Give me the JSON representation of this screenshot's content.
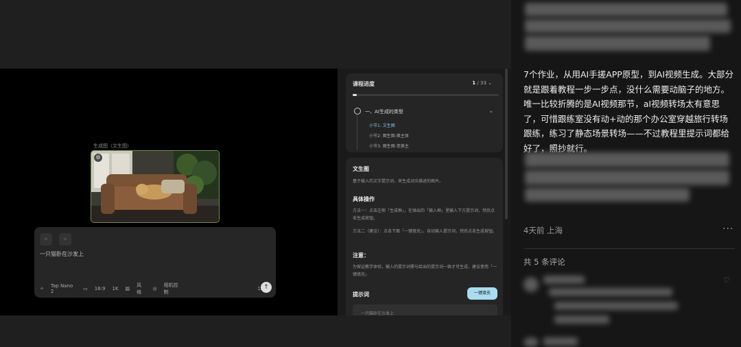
{
  "toolbar": {
    "icons": [
      "undo-icon",
      "redo-icon",
      "crop-icon",
      "rotate-icon",
      "more-icon",
      "folder-icon",
      "download-icon",
      "expand-icon"
    ],
    "more_glyph": "•••"
  },
  "image": {
    "caption": "生成图（文生图）",
    "badge_glyph": "⚙"
  },
  "prompt_box": {
    "text": "一只猫卧在沙发上",
    "model": "Tap Nano 2",
    "ratio": "16:9",
    "resolution": "1K",
    "style": "风格",
    "camera": "相机控制",
    "count": "1x"
  },
  "course": {
    "title": "课程进度",
    "current": "1",
    "total": "/ 33",
    "progress": 0.03,
    "section": "一、AI生成的类型",
    "lessons": [
      {
        "label": "小节1: 文生图",
        "active": true
      },
      {
        "label": "小节2: 图生图-换主体",
        "active": false
      },
      {
        "label": "小节3: 图生图-变换主",
        "active": false
      }
    ]
  },
  "detail": {
    "title": "文生图",
    "desc": "基于输入的文字提示词，来生成对应描述的图片。",
    "ops_title": "具体操作",
    "method1": "方法一：点击左侧「生成框」，在弹出的「输入框」里输入下方提示词，然后点击生成按钮。",
    "method2": "方法二（建议）：点击下面「一键填充」，自动输入提示词，然后点击生成按钮。",
    "note_title": "注意：",
    "note": "为保证教学体验，输入的提示词需与给出的提示词一致才可生成，建议使用「一键填充」",
    "prompt_title": "提示词",
    "fill_button": "一键填充",
    "prompt_text": "一只猫卧在沙发上"
  },
  "post": {
    "body": "7个作业，从用AI手搓APP原型，到AI视频生成。大部分就是跟着教程一步一步点，没什么需要动脑子的地方。唯一比较折腾的是AI视频那节，aI视频转场太有意思了，可惜跟练室没有动+动的那个办公室穿越旅行转场跟练，练习了静态场景转场——不过教程里提示词都给好了，照抄就行。",
    "meta": "4天前 上海",
    "more": "···",
    "comment_count": "共 5 条评论",
    "heart_glyph": "♡"
  }
}
